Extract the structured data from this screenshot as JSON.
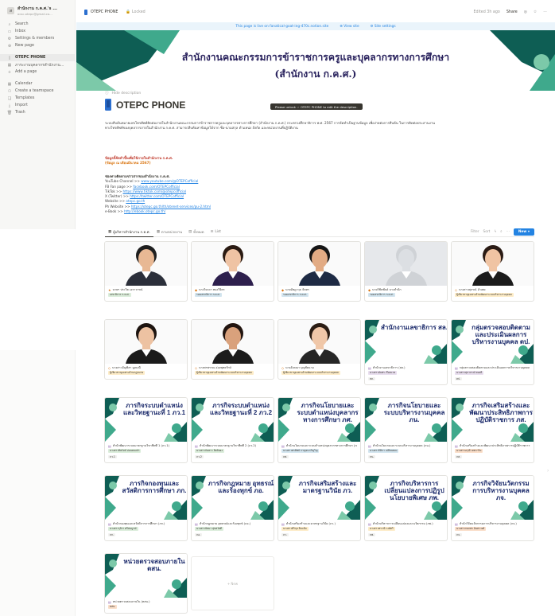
{
  "sidebar": {
    "workspace_name": "สำนักงาน ก.ค.ศ.'s ...",
    "workspace_sub": "ocsc.otepc@gmail.co...",
    "items": [
      {
        "label": "Search",
        "icon": "search-icon"
      },
      {
        "label": "Inbox",
        "icon": "inbox-icon"
      },
      {
        "label": "Settings & members",
        "icon": "gear-icon"
      },
      {
        "label": "New page",
        "icon": "plus-icon"
      }
    ],
    "pages": [
      {
        "label": "OTEPC PHONE",
        "icon": "phone-icon"
      },
      {
        "label": "ภาระงานบุคลากรสำนักงาน...",
        "icon": "table-icon"
      },
      {
        "label": "Add a page",
        "icon": "plus-icon"
      }
    ],
    "footer": [
      {
        "label": "Calendar",
        "icon": "calendar-icon"
      },
      {
        "label": "Create a teamspace",
        "icon": "people-icon"
      },
      {
        "label": "Templates",
        "icon": "template-icon"
      },
      {
        "label": "Import",
        "icon": "import-icon"
      },
      {
        "label": "Trash",
        "icon": "trash-icon"
      }
    ]
  },
  "topbar": {
    "page": "OTEPC PHONE",
    "lock": "Locked",
    "edited": "Edited 3h ago",
    "share": "Share"
  },
  "live": {
    "text": "This page is live on fanatical-goat-ing-470c.notion.site",
    "view_site": "View site",
    "site_settings": "Site settings"
  },
  "banner": {
    "line1": "สำนักงานคณะกรรมการข้าราชการครูและบุคลากรทางการศึกษา",
    "line2": "(สำนักงาน ก.ค.ศ.)"
  },
  "page": {
    "hide_description": "Hide description",
    "title": "OTEPC PHONE",
    "unlock": "Please unlock ☞ OTEPC PHONE to edit the description.",
    "desc": "ระบบสืบค้นหมายเลขโทรศัพท์ติดต่อภายในสำนักงานคณะกรรมการข้าราชการครูและบุคลากรทางการศึกษา (สำนักงาน ก.ค.ศ.) กระทรวงศึกษาธิการ พ.ศ. 2567 การจัดทำเป็นฐานข้อมูล เพื่อง่ายต่อการสืบค้น ในการติดต่อประสานงานทางโทรศัพท์ของบุคลากรภายในสำนักงาน ก.ค.ศ. สามารถสืบค้นหาข้อมูลได้จาก ชื่อ-นามสกุล ตำแหน่ง สังกัด และหน่วยงานที่ปฏิบัติงาน",
    "note1": "ข้อมูลนี้จัดทำขึ้นเพื่อใช้ภายในสำนักงาน ก.ค.ศ.",
    "note2": "(ข้อมูล ณ เดือนมีนาคม 2567)",
    "channels_title": "ช่องทางติดตามข่าวสารของสำนักงาน ก.ค.ศ.",
    "channels": [
      {
        "label": "YouTube Channel >> ",
        "link": "www.youtube.com/@OTEPCofficial"
      },
      {
        "label": "FB Fan page >> ",
        "link": "facebook.com/OTEPCofficial"
      },
      {
        "label": "TikTok >> ",
        "link": "https://www.tiktok.com/@otepcofficial"
      },
      {
        "label": "X (Twitter) >> ",
        "link": "https://twitter.com/OTEPCofficial"
      },
      {
        "label": "Website >> ",
        "link": "otepc.go.th"
      },
      {
        "label": "Ph Website >> ",
        "link": "https://otepc.go.th/th/otenet-services/pu-2.html"
      },
      {
        "label": "e-Book >> ",
        "link": "http://ebook.otepc.go.th/"
      }
    ]
  },
  "views": {
    "tabs": [
      "ผู้บริหารสำนักงาน ก.ค.ศ.",
      "ตามหน่วยงาน",
      "ทั้งหมด",
      "List"
    ],
    "filter": "Filter",
    "sort": "Sort",
    "new": "New"
  },
  "cards": [
    {
      "kind": "person",
      "title": "นายฯ ประวิต เอราวรรณ์",
      "tag": "เลขาธิการ ก.ค.ศ.",
      "tag_color": "#dbeddb",
      "suit": "#2b2f3a",
      "skin": "#e8b894",
      "hair": "#1f1f1f",
      "bg": "#fafafa",
      "icon": "★"
    },
    {
      "kind": "person",
      "title": "นางวิยะดา ทองวิจิตร",
      "tag": "รองเลขาธิการ ก.ค.ศ.",
      "tag_color": "#d3e5ef",
      "suit": "#2d1f4d",
      "skin": "#efc3a4",
      "hair": "#2a1a12",
      "bg": "#fafafa",
      "icon": "◆"
    },
    {
      "kind": "person",
      "title": "นายอัษฎาวุธ จันทร",
      "tag": "รองเลขาธิการ ก.ค.ศ.",
      "tag_color": "#d3e5ef",
      "suit": "#1e2a44",
      "skin": "#e2ab84",
      "hair": "#161616",
      "bg": "#fafafa",
      "icon": "◆"
    },
    {
      "kind": "person",
      "title": "นายวิชิตพันธ์ บางสำนัก",
      "tag": "รองเลขาธิการ ก.ค.ศ.",
      "tag_color": "#d3e5ef",
      "suit": "#cfd2d6",
      "skin": "#dcdfe3",
      "hair": "#cfd2d6",
      "bg": "#e6e8eb",
      "icon": "◆"
    },
    {
      "kind": "person",
      "title": "นางสาวศุภรณ์ อำเพย",
      "tag": "ผู้เชี่ยวชาญเฉพาะด้านพัฒนาระบบบริหารงานบุคคล",
      "tag_color": "#fdecc8",
      "suit": "#1b1b1b",
      "skin": "#f0c4a3",
      "hair": "#2a1b14",
      "bg": "#fafafa",
      "icon": "◇"
    },
    {
      "kind": "person",
      "title": "นางสาวอัญชิสา มูลมณี",
      "tag": "ผู้เชี่ยวชาญเฉพาะด้านกฎหมาย",
      "tag_color": "#fdecc8",
      "suit": "#1b1b1b",
      "skin": "#edc2a2",
      "hair": "#1d1410",
      "bg": "#fafafa",
      "icon": "◇"
    },
    {
      "kind": "person",
      "title": "นางพรพรรณ อ่องพุทธรักษ์",
      "tag": "ผู้เชี่ยวชาญเฉพาะด้านพัฒนาระบบบริหารงานบุคคล",
      "tag_color": "#fdecc8",
      "suit": "#1c1c1c",
      "skin": "#d9a17c",
      "hair": "#221510",
      "bg": "#fafafa",
      "icon": "◇"
    },
    {
      "kind": "person",
      "title": "นางอังคณา บุญชัยนาม",
      "tag": "ผู้เชี่ยวชาญเฉพาะด้านพัฒนาระบบบริหารงานบุคคล",
      "tag_color": "#fdecc8",
      "suit": "#262626",
      "skin": "#f0c7a8",
      "hair": "#2b1d14",
      "bg": "#fafafa",
      "icon": "◇"
    },
    {
      "kind": "unit",
      "title": "สำนักงานเลขาธิการ (สล.)",
      "label": "สำนักงานเลขาธิการ สล.",
      "tag": "นางสาวอัมพร เรืองนาค",
      "tag2": "สล.",
      "tag_color": "#e8deee",
      "icon": "▤"
    },
    {
      "kind": "unit",
      "title": "กลุ่มตรวจสอบติดตามและประเมินผลการบริหารงานบุคคล (ตป.)",
      "label": "กลุ่มตรวจสอบติดตามและประเมินผลการบริหารงานบุคคล ตป.",
      "tag": "นางสาวสุภาภรณ์ ทองดี",
      "tag2": "ตป.",
      "tag_color": "#e8deee",
      "icon": "▤"
    },
    {
      "kind": "unit",
      "title": "สำนักพัฒนาระบบมาตรฐานวิชาชีพที่ 1 (ภว.1)",
      "label": "ภารกิจระบบตำแหน่งและวิทยฐานะที่ 1 ภว.1",
      "tag": "นางสาวทิพวัลย์ อ่อนทองคำ",
      "tag2": "ภว.1",
      "tag_color": "#dbeddb",
      "icon": "▤"
    },
    {
      "kind": "unit",
      "title": "สำนักพัฒนาระบบมาตรฐานวิชาชีพที่ 2 (ภว.2)",
      "label": "ภารกิจระบบตำแหน่งและวิทยฐานะที่ 2 ภว.2",
      "tag": "นางสาวจันทรา สิงห์ทอง",
      "tag2": "ภว.2",
      "tag_color": "#dbeddb",
      "icon": "▤"
    },
    {
      "kind": "unit",
      "title": "สำนักนโยบายและระบบตำแหน่งบุคลากรทางการศึกษา (ภศ.)",
      "label": "ภารกิจนโยบายและระบบตำแหน่งบุคลากรทางการศึกษา ภศ.",
      "tag": "นางสาวพรทิพย์ กาญจนาภิญโญ",
      "tag2": "ภศ.",
      "tag_color": "#d3e5ef",
      "icon": "▤"
    },
    {
      "kind": "unit",
      "title": "สำนักนโยบายและระบบบริหารงานบุคคล (ภน.)",
      "label": "ภารกิจนโยบายและระบบบริหารงานบุคคล ภน.",
      "tag": "นางสาวกิติกา เปลี่ยนทอง",
      "tag2": "ภน.",
      "tag_color": "#d3e5ef",
      "icon": "▤"
    },
    {
      "kind": "unit",
      "title": "สำนักเสริมสร้างและพัฒนาประสิทธิภาพการปฏิบัติราชการ (ภส.)",
      "label": "ภารกิจเสริมสร้างและพัฒนาประสิทธิภาพการปฏิบัติราชการ ภส.",
      "tag": "นางสาวอรุณี เทพวาริน",
      "tag2": "ภส.",
      "tag_color": "#fadec9",
      "icon": "▤"
    },
    {
      "kind": "unit",
      "title": "สำนักกองทุนและสวัสดิการการศึกษา (ภก.)",
      "label": "ภารกิจกองทุนและสวัสดิการการศึกษา ภก.",
      "tag": "นางสาวรุจิรา ศรีสมบูรณ์",
      "tag2": "ภก.",
      "tag_color": "#dbeddb",
      "icon": "▤"
    },
    {
      "kind": "unit",
      "title": "สำนักกฎหมาย อุทธรณ์และร้องทุกข์ (ภอ.)",
      "label": "ภารกิจกฎหมาย อุทธรณ์ และร้องทุกข์ ภอ.",
      "tag": "นางสาวปัทมา สุขสวัสดิ์",
      "tag2": "ภอ.",
      "tag_color": "#dbeddb",
      "icon": "▤"
    },
    {
      "kind": "unit",
      "title": "สำนักเสริมสร้างและมาตรฐานวินัย (ภว.)",
      "label": "ภารกิจเสริมสร้างและมาตรฐานวินัย ภว.",
      "tag": "นางสาวศิริกุล ยิ้มแย้ม",
      "tag2": "ภว.",
      "tag_color": "#fdecc8",
      "icon": "▤"
    },
    {
      "kind": "unit",
      "title": "สำนักบริหารการเปลี่ยนแปลงและนวัตกรรม (ภพ.)",
      "label": "ภารกิจบริหารการเปลี่ยนแปลงการปฏิรูปนโยบายพิเศษ ภพ.",
      "tag": "นางสาวพรรณี วงศ์ศรี",
      "tag2": "ภพ.",
      "tag_color": "#fdecc8",
      "icon": "▤"
    },
    {
      "kind": "unit",
      "title": "สำนักวิจัยนวัตกรรมการบริหารงานบุคคล (ภจ.)",
      "label": "ภารกิจวิจัยนวัตกรรมการบริหารงานบุคคล ภจ.",
      "tag": "นางสาวกนกพร อินทรวงศ์",
      "tag2": "ภจ.",
      "tag_color": "#fadec9",
      "icon": "▤"
    },
    {
      "kind": "unit",
      "title": "หน่วยตรวจสอบภายใน (ตสน.)",
      "label": "หน่วยตรวจสอบภายใน ตสน.",
      "tag": "ตสน.",
      "tag2": "",
      "tag_color": "#fadec9",
      "icon": "▤"
    }
  ],
  "new_card": "+ New",
  "colors": {
    "accent": "#2383e2",
    "banner_text": "#2a235e",
    "teal": "#3fa98c",
    "deep_teal": "#0e5e54"
  }
}
